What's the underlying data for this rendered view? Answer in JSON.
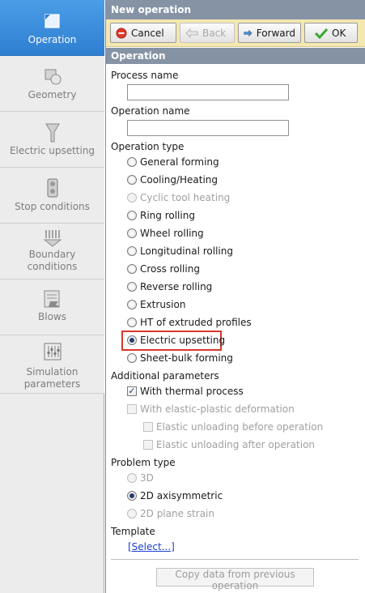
{
  "sidebar": {
    "items": [
      {
        "label": "Operation",
        "icon": "operation-icon"
      },
      {
        "label": "Geometry",
        "icon": "geometry-icon"
      },
      {
        "label": "Electric upsetting",
        "icon": "electric-upsetting-icon"
      },
      {
        "label": "Stop conditions",
        "icon": "stop-conditions-icon"
      },
      {
        "label": "Boundary conditions",
        "icon": "boundary-conditions-icon"
      },
      {
        "label": "Blows",
        "icon": "blows-icon"
      },
      {
        "label": "Simulation parameters",
        "icon": "simulation-parameters-icon"
      }
    ]
  },
  "panel": {
    "title": "New operation",
    "section": "Operation"
  },
  "toolbar": {
    "cancel": "Cancel",
    "back": "Back",
    "forward": "Forward",
    "ok": "OK"
  },
  "form": {
    "process_name_label": "Process name",
    "process_name_value": "",
    "operation_name_label": "Operation name",
    "operation_name_value": "",
    "operation_type_label": "Operation type",
    "operation_types": [
      "General forming",
      "Cooling/Heating",
      "Cyclic tool heating",
      "Ring rolling",
      "Wheel rolling",
      "Longitudinal rolling",
      "Cross rolling",
      "Reverse rolling",
      "Extrusion",
      "HT of extruded profiles",
      "Electric upsetting",
      "Sheet-bulk forming"
    ],
    "selected_operation_type": "Electric upsetting",
    "additional_label": "Additional parameters",
    "with_thermal": "With thermal process",
    "with_elastic": "With elastic-plastic deformation",
    "unload_before": "Elastic unloading before operation",
    "unload_after": "Elastic unloading after operation",
    "problem_type_label": "Problem type",
    "problem_types": [
      "3D",
      "2D axisymmetric",
      "2D plane strain"
    ],
    "selected_problem_type": "2D axisymmetric",
    "template_label": "Template",
    "template_link": "[Select...]",
    "copy_button": "Copy data from previous operation"
  },
  "colors": {
    "header": "#8593a5",
    "toolbar": "#f4e7b0",
    "active_tab": "#3a8fdd",
    "highlight": "#d9362c",
    "link": "#1a3fd1"
  }
}
